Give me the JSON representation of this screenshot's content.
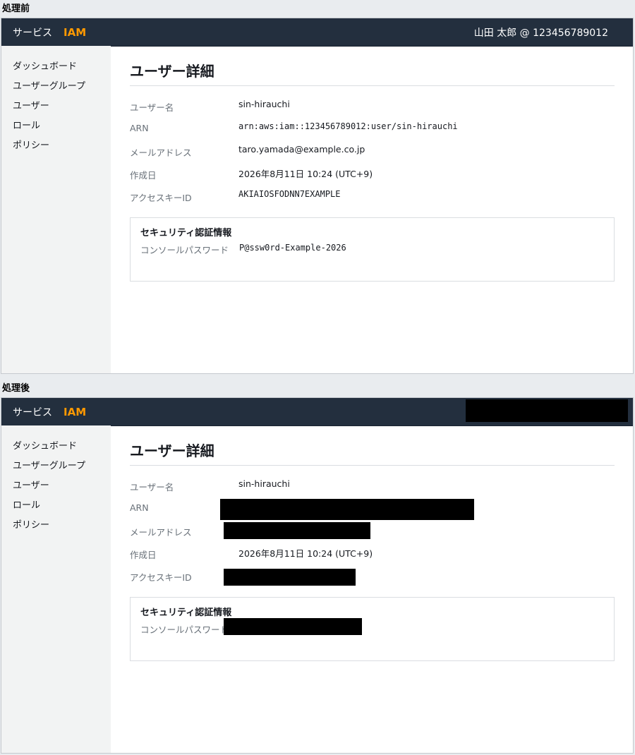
{
  "sections": {
    "before_label": "処理前",
    "after_label": "処理後"
  },
  "topbar": {
    "services": "サービス",
    "app": "IAM",
    "account": "山田 太郎 @ 123456789012"
  },
  "sidebar": {
    "items": [
      {
        "label": "ダッシュボード"
      },
      {
        "label": "ユーザーグループ"
      },
      {
        "label": "ユーザー"
      },
      {
        "label": "ロール"
      },
      {
        "label": "ポリシー"
      }
    ]
  },
  "detail": {
    "title": "ユーザー詳細",
    "username_label": "ユーザー名",
    "username": "sin-hirauchi",
    "arn_label": "ARN",
    "arn": "arn:aws:iam::123456789012:user/sin-hirauchi",
    "email_label": "メールアドレス",
    "email": "taro.yamada@example.co.jp",
    "created_label": "作成日",
    "created": "2026年8月11日 10:24 (UTC+9)",
    "access_key_label": "アクセスキーID",
    "access_key": "AKIAIOSFODNN7EXAMPLE"
  },
  "credentials": {
    "title": "セキュリティ認証情報",
    "password_label": "コンソールパスワード",
    "password": "P@ssw0rd-Example-2026"
  },
  "colors": {
    "topbar": "#232f3e",
    "accent": "#ff9900",
    "sidebar": "#f2f3f3",
    "redaction": "#000000"
  }
}
